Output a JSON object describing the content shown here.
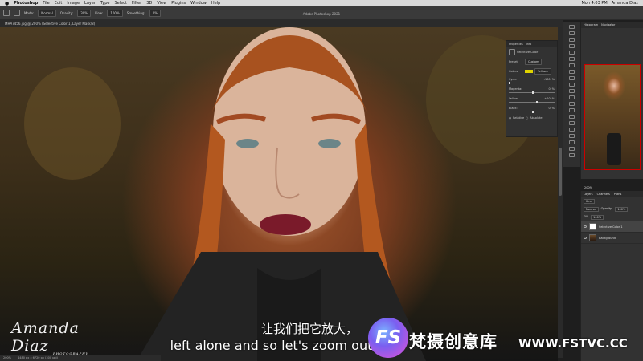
{
  "menubar": {
    "app": "Photoshop",
    "items": [
      "File",
      "Edit",
      "Image",
      "Layer",
      "Type",
      "Select",
      "Filter",
      "3D",
      "View",
      "Plugins",
      "Window",
      "Help"
    ],
    "right": [
      "Mon 4:03 PM",
      "Amanda Diaz"
    ]
  },
  "optionsbar": {
    "mode_label": "Mode:",
    "mode_value": "Normal",
    "opacity_label": "Opacity:",
    "opacity_value": "30%",
    "flow_label": "Flow:",
    "flow_value": "100%",
    "smoothing_label": "Smoothing:",
    "smoothing_value": "0%"
  },
  "window_title": "Adobe Photoshop 2021",
  "document_tab": "MHA7456.jpg @ 200% (Selective Color 1, Layer Mask/8)",
  "properties": {
    "tabs": [
      "Properties",
      "Info"
    ],
    "title": "Selective Color",
    "preset_label": "Preset:",
    "preset_value": "Custom",
    "colors_label": "Colors:",
    "colors_value": "Yellows",
    "colors_swatch": "#e0d300",
    "sliders": [
      {
        "label": "Cyan:",
        "value": "-100",
        "unit": "%"
      },
      {
        "label": "Magenta:",
        "value": "0",
        "unit": "%"
      },
      {
        "label": "Yellow:",
        "value": "+20",
        "unit": "%"
      },
      {
        "label": "Black:",
        "value": "0",
        "unit": "%"
      }
    ],
    "methods": [
      "Relative",
      "Absolute"
    ]
  },
  "navigator": {
    "tabs": [
      "Histogram",
      "Navigator"
    ],
    "zoom": "200%"
  },
  "layers": {
    "tabs": [
      "Layers",
      "Channels",
      "Paths"
    ],
    "kind_label": "Kind",
    "blend_value": "Normal",
    "opacity_label": "Opacity:",
    "opacity_value": "100%",
    "fill_label": "Fill:",
    "fill_value": "100%",
    "items": [
      {
        "name": "Selective Color 1",
        "selected": true
      },
      {
        "name": "Background",
        "selected": false
      }
    ]
  },
  "status": {
    "zoom": "200%",
    "doc": "4480 px x 6720 px (300 ppi)"
  },
  "subtitles": {
    "chinese": "让我们把它放大，",
    "english": "left alone and so let's zoom out"
  },
  "watermark": {
    "signature": "Amanda Diaz",
    "sub": "PHOTOGRAPHY",
    "logo_letters": "FS",
    "brand_cn": "梵摄创意库",
    "url": "WWW.FSTVC.CC"
  }
}
